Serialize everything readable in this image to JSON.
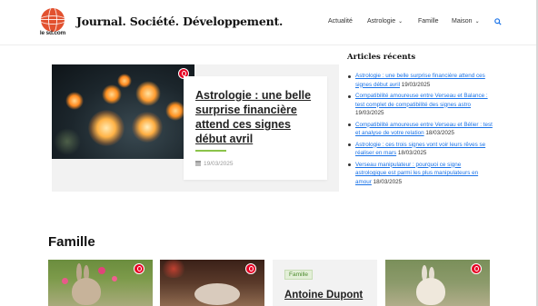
{
  "header": {
    "logo_text": "le sd.com",
    "site_title": "Journal. Société. Développement.",
    "nav": [
      {
        "label": "Actualité",
        "has_dropdown": false
      },
      {
        "label": "Astrologie",
        "has_dropdown": true
      },
      {
        "label": "Famille",
        "has_dropdown": false
      },
      {
        "label": "Maison",
        "has_dropdown": true
      }
    ],
    "search_icon": "search-icon"
  },
  "featured": {
    "title": "Astrologie : une belle surprise financière attend ces signes début avril",
    "date": "19/03/2025",
    "pin_icon": "pinterest-icon"
  },
  "sidebar": {
    "title": "Articles récents",
    "items": [
      {
        "link": "Astrologie : une belle surprise financière attend ces signes début avril",
        "date": "19/03/2025"
      },
      {
        "link": "Compatibilité amoureuse entre Verseau et Balance : test complet de compatibilité des signes astro",
        "date": "19/03/2025"
      },
      {
        "link": "Compatibilité amoureuse entre Verseau et Bélier : test et analyse de votre relation",
        "date": "18/03/2025"
      },
      {
        "link": "Astrologie : ces trois signes vont voir leurs rêves se réaliser en mars",
        "date": "18/03/2025"
      },
      {
        "link": "Verseau manipulateur : pourquoi ce signe astrologique est parmi les plus manipulateurs en amour",
        "date": "18/03/2025"
      }
    ]
  },
  "famille": {
    "title": "Famille",
    "card3_tag": "Famille",
    "card3_title": "Antoine Dupont"
  },
  "colors": {
    "accent": "#8bc34a",
    "link": "#1a73e8",
    "logo": "#e2512f",
    "pinterest": "#e60023"
  }
}
